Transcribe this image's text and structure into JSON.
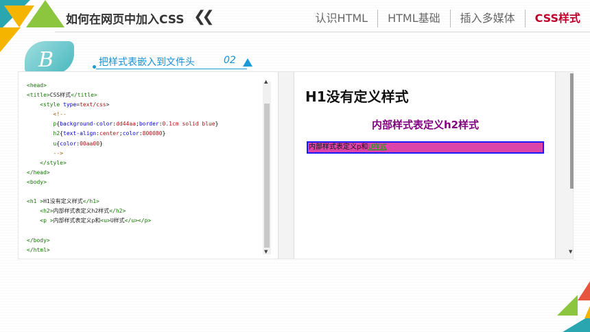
{
  "header": {
    "title": "如何在网页中加入CSS",
    "chevron": "❮❮",
    "nav": [
      {
        "label": "认识HTML",
        "active": false
      },
      {
        "label": "HTML基础",
        "active": false
      },
      {
        "label": "插入多媒体",
        "active": false
      },
      {
        "label": "CSS样式",
        "active": true
      }
    ]
  },
  "section": {
    "badge_letter": "B",
    "subtitle": "把样式表嵌入到文件头",
    "number": "02"
  },
  "code": {
    "lines": [
      "<head>",
      "<title>CSS样式</title>",
      "    <style type=text/css>",
      "        <!--",
      "        p{background-color:dd44aa;border:0.1cm solid blue}",
      "        h2{text-align:center;color:800080}",
      "        u{color:00aa00}",
      "        -->",
      "    </style>",
      "</head>",
      "<body>",
      "",
      "<h1 >H1没有定义样式</h1>",
      "    <h2>内部样式表定义h2样式</h2>",
      "    <p >内部样式表定义p和<u>U样式</u></p>",
      "",
      "</body>",
      "</html>"
    ]
  },
  "preview": {
    "h1": "H1没有定义样式",
    "h2": "内部样式表定义h2样式",
    "p_text": "内部样式表定义p和",
    "u_text": "U样式"
  },
  "colors": {
    "accent_red": "#c0002a",
    "teal": "#2aa6b0",
    "yellow": "#f5b400",
    "green": "#8cc63f",
    "blue": "#1a9ad6",
    "p_bg": "#dd44aa",
    "h2_color": "#800080",
    "u_color": "#00aa00"
  }
}
